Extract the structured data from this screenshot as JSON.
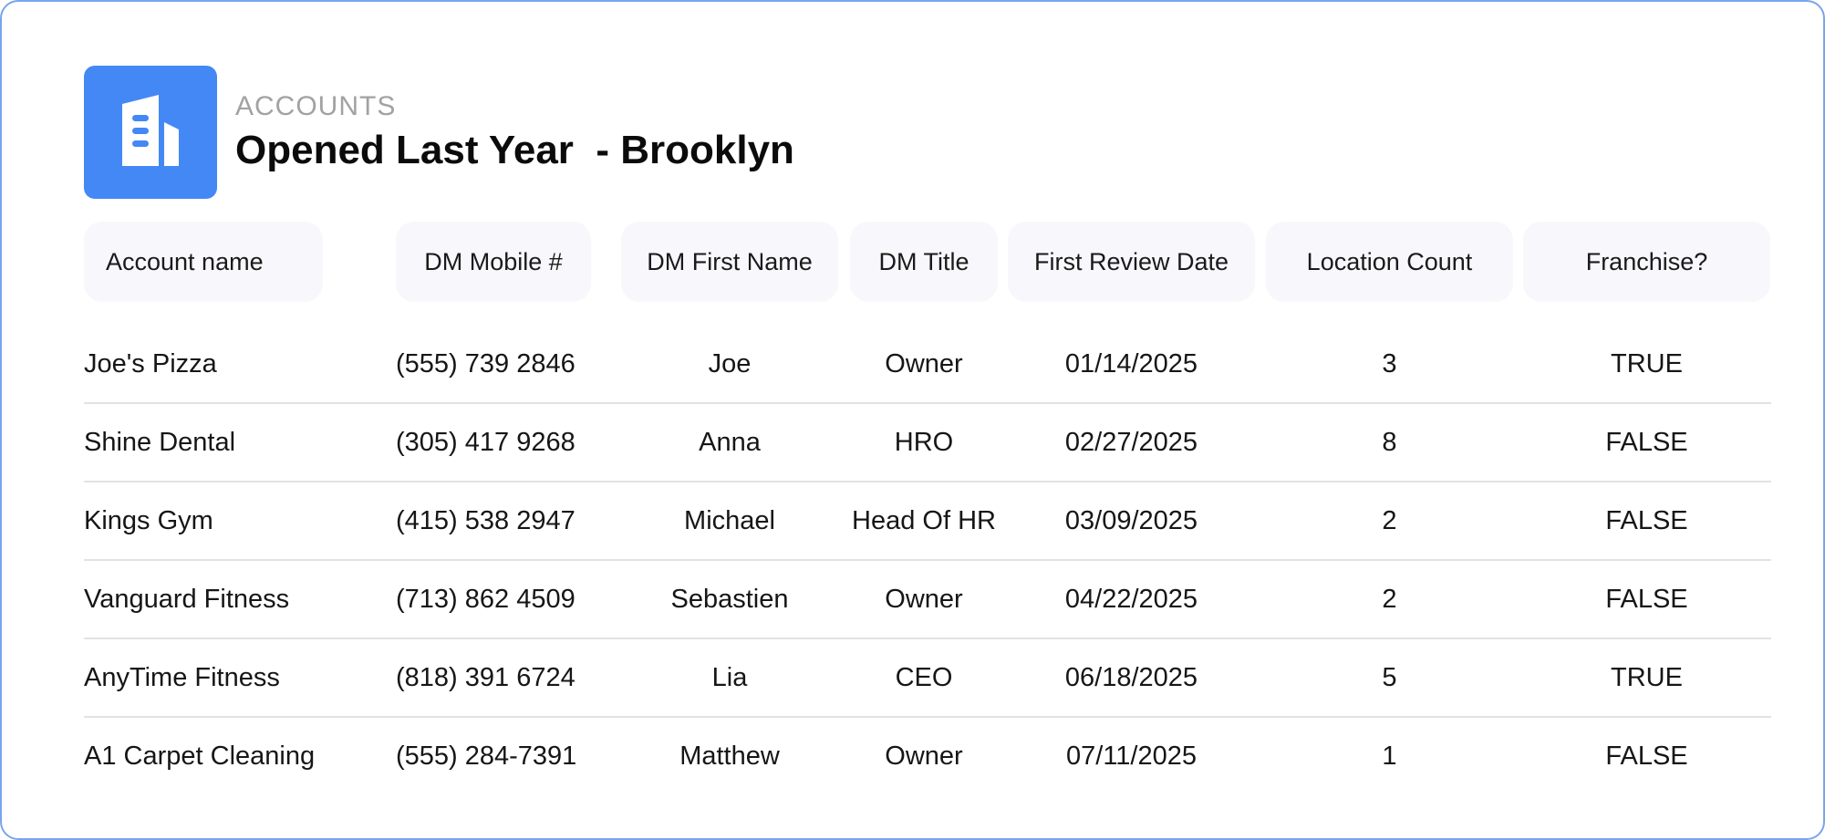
{
  "header": {
    "section": "ACCOUNTS",
    "title": "Opened Last Year  - Brooklyn",
    "icon": "building-icon",
    "accent_color": "#4488f6"
  },
  "table": {
    "columns": [
      "Account name",
      "DM Mobile #",
      "DM First Name",
      "DM Title",
      "First Review Date",
      "Location Count",
      "Franchise?"
    ],
    "rows": [
      [
        "Joe's Pizza",
        "(555) 739 2846",
        "Joe",
        "Owner",
        "01/14/2025",
        "3",
        "TRUE"
      ],
      [
        "Shine Dental",
        "(305) 417 9268",
        "Anna",
        "HRO",
        "02/27/2025",
        "8",
        "FALSE"
      ],
      [
        "Kings Gym",
        "(415) 538 2947",
        "Michael",
        "Head Of HR",
        "03/09/2025",
        "2",
        "FALSE"
      ],
      [
        "Vanguard Fitness",
        "(713) 862 4509",
        "Sebastien",
        "Owner",
        "04/22/2025",
        "2",
        "FALSE"
      ],
      [
        "AnyTime Fitness",
        "(818) 391 6724",
        "Lia",
        "CEO",
        "06/18/2025",
        "5",
        "TRUE"
      ],
      [
        "A1 Carpet Cleaning",
        "(555) 284-7391",
        "Matthew",
        "Owner",
        "07/11/2025",
        "1",
        "FALSE"
      ]
    ]
  }
}
